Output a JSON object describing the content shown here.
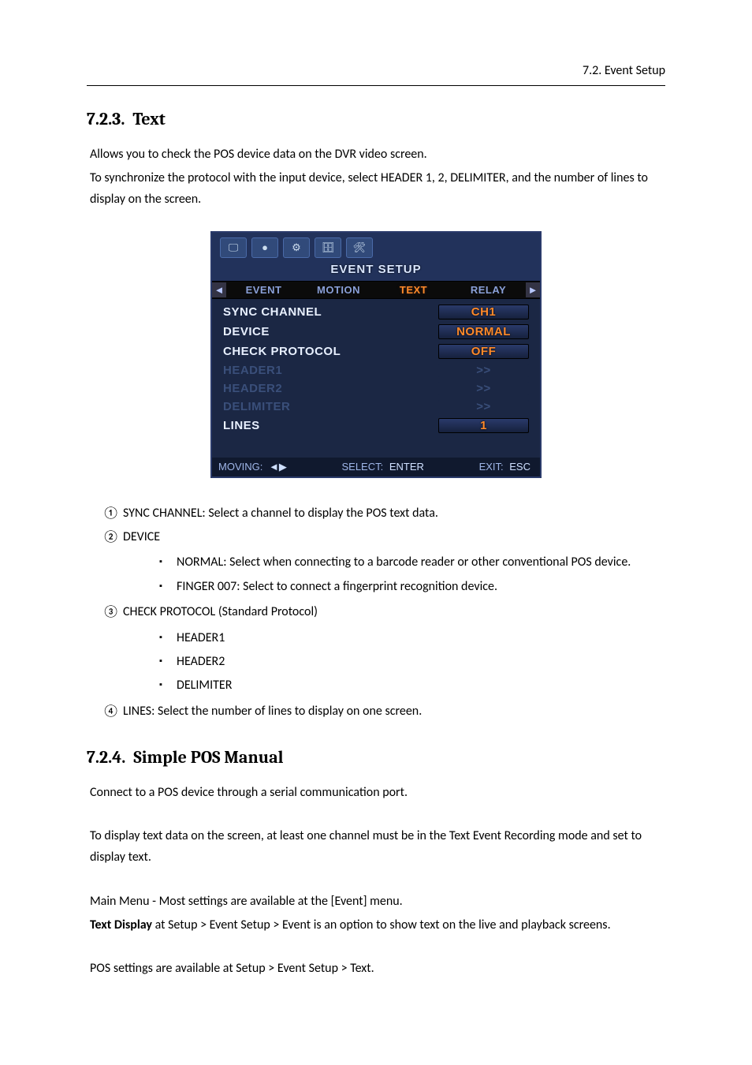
{
  "header": {
    "breadcrumb": "7.2. Event Setup"
  },
  "section1": {
    "number": "7.2.3.",
    "title": "Text",
    "intro1": "Allows you to check the POS device data on the DVR video screen.",
    "intro2": "To synchronize the protocol with the input device, select HEADER 1, 2, DELIMITER, and the number of lines to display on the screen."
  },
  "screenshot": {
    "setup_title": "EVENT SETUP",
    "tabs": {
      "arrow_left": "◄",
      "arrow_right": "►",
      "items": [
        {
          "label": "EVENT",
          "active": false
        },
        {
          "label": "MOTION",
          "active": false
        },
        {
          "label": "TEXT",
          "active": true
        },
        {
          "label": "RELAY",
          "active": false
        }
      ]
    },
    "rows": [
      {
        "label": "SYNC CHANNEL",
        "value": "CH1",
        "em": true,
        "dim": false
      },
      {
        "label": "DEVICE",
        "value": "NORMAL",
        "em": true,
        "dim": false
      },
      {
        "label": "CHECK PROTOCOL",
        "value": "OFF",
        "em": true,
        "dim": false
      },
      {
        "label": "HEADER1",
        "value": ">>",
        "em": false,
        "dim": true
      },
      {
        "label": "HEADER2",
        "value": ">>",
        "em": false,
        "dim": true
      },
      {
        "label": "DELIMITER",
        "value": ">>",
        "em": false,
        "dim": true
      },
      {
        "label": "LINES",
        "value": "1",
        "em": true,
        "dim": false
      }
    ],
    "footer": {
      "moving_label": "MOVING:",
      "moving_key": "◄▶",
      "select_label": "SELECT:",
      "select_key": "ENTER",
      "exit_label": "EXIT:",
      "exit_key": "ESC"
    },
    "toolbar_icons": [
      "monitor-icon",
      "rec-icon",
      "network-icon",
      "storage-icon",
      "tools-icon"
    ]
  },
  "list1": {
    "items": [
      {
        "marker": "①",
        "text": "SYNC CHANNEL: Select a channel to display the POS text data."
      },
      {
        "marker": "②",
        "text": "DEVICE",
        "sub": [
          "NORMAL: Select when connecting to a barcode reader or other conventional POS device.",
          "FINGER 007: Select to connect a fingerprint recognition device."
        ]
      },
      {
        "marker": "③",
        "text": "CHECK PROTOCOL (Standard Protocol)",
        "sub": [
          "HEADER1",
          "HEADER2",
          "DELIMITER"
        ]
      },
      {
        "marker": "④",
        "text": "LINES: Select the number of lines to display on one screen."
      }
    ]
  },
  "section2": {
    "number": "7.2.4.",
    "title": "Simple POS Manual",
    "p1": "Connect to a POS device through a serial communication port.",
    "p2": "To display text data on the screen, at least one channel must be in the Text Event Recording mode and set to display text.",
    "p3": "Main Menu - Most settings are available at the [Event] menu.",
    "p4_bold": "Text Display",
    "p4_rest": " at Setup > Event Setup > Event is an option to show text on the live and playback screens.",
    "p5": "POS settings are available at Setup > Event Setup > Text."
  }
}
